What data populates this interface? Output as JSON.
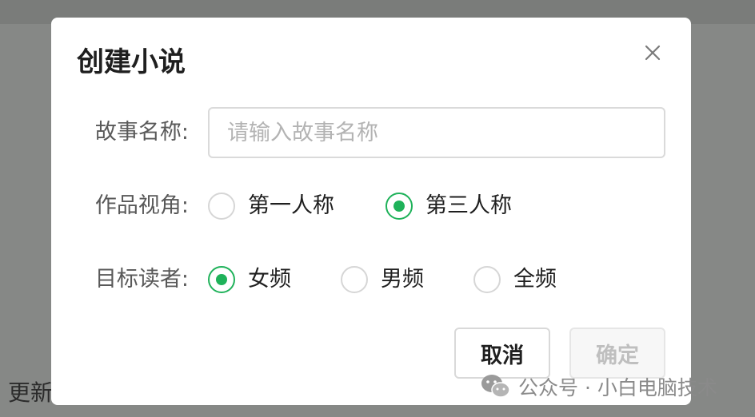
{
  "background": {
    "partial_text": "更新"
  },
  "dialog": {
    "title": "创建小说",
    "close_icon": "close-icon",
    "fields": {
      "story_name": {
        "label": "故事名称:",
        "value": "",
        "placeholder": "请输入故事名称"
      },
      "perspective": {
        "label": "作品视角:",
        "options": [
          {
            "label": "第一人称",
            "checked": false
          },
          {
            "label": "第三人称",
            "checked": true
          }
        ]
      },
      "audience": {
        "label": "目标读者:",
        "options": [
          {
            "label": "女频",
            "checked": true
          },
          {
            "label": "男频",
            "checked": false
          },
          {
            "label": "全频",
            "checked": false
          }
        ]
      }
    },
    "buttons": {
      "cancel": "取消",
      "confirm": "确定",
      "confirm_disabled": true
    }
  },
  "watermark": {
    "icon": "wechat-icon",
    "text": "公众号 · 小白电脑技术"
  },
  "colors": {
    "accent": "#1fb25a",
    "overlay": "#868886"
  }
}
